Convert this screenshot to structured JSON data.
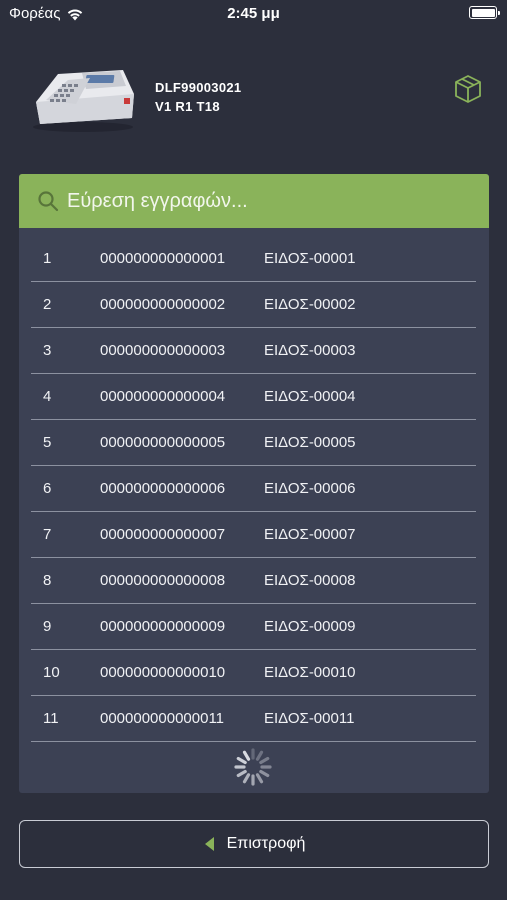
{
  "status_bar": {
    "carrier": "Φορέας",
    "time": "2:45 μμ"
  },
  "device": {
    "serial": "DLF99003021",
    "version": "V1 R1 T18",
    "image_icon": "cash-register-icon",
    "action_icon": "box-icon"
  },
  "search": {
    "placeholder": "Εύρεση εγγραφών...",
    "value": "",
    "icon": "search-icon"
  },
  "items": [
    {
      "num": "1",
      "code": "000000000000001",
      "name": "ΕΙΔΟΣ-00001"
    },
    {
      "num": "2",
      "code": "000000000000002",
      "name": "ΕΙΔΟΣ-00002"
    },
    {
      "num": "3",
      "code": "000000000000003",
      "name": "ΕΙΔΟΣ-00003"
    },
    {
      "num": "4",
      "code": "000000000000004",
      "name": "ΕΙΔΟΣ-00004"
    },
    {
      "num": "5",
      "code": "000000000000005",
      "name": "ΕΙΔΟΣ-00005"
    },
    {
      "num": "6",
      "code": "000000000000006",
      "name": "ΕΙΔΟΣ-00006"
    },
    {
      "num": "7",
      "code": "000000000000007",
      "name": "ΕΙΔΟΣ-00007"
    },
    {
      "num": "8",
      "code": "000000000000008",
      "name": "ΕΙΔΟΣ-00008"
    },
    {
      "num": "9",
      "code": "000000000000009",
      "name": "ΕΙΔΟΣ-00009"
    },
    {
      "num": "10",
      "code": "000000000000010",
      "name": "ΕΙΔΟΣ-00010"
    },
    {
      "num": "11",
      "code": "000000000000011",
      "name": "ΕΙΔΟΣ-00011"
    }
  ],
  "back_button": {
    "label": "Επιστροφή",
    "icon": "back-arrow-icon"
  },
  "colors": {
    "background": "#2c2f3c",
    "panel": "#3c4154",
    "accent": "#8ab35a"
  }
}
